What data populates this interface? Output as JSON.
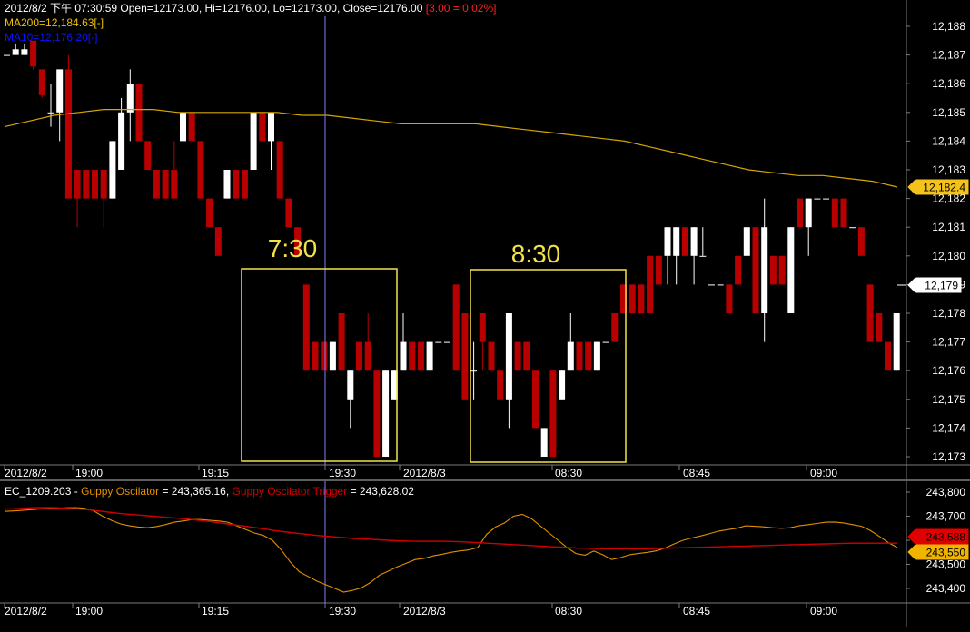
{
  "header": {
    "ohlc_text": "2012/8/2 下午 07:30:59 Open=12173.00, Hi=12176.00, Lo=12173.00, Close=12176.00",
    "change_text": "[3.00 = 0.02%]",
    "ma200_text": "MA200=12,184.63[-]",
    "ma10_text": "MA10=12,176.20[-]"
  },
  "colors": {
    "background": "#000000",
    "grid": "#7a7a7a",
    "up_candle": "#ffffff",
    "down_candle": "#b80000",
    "ma200": "#d4a600",
    "box": "#f2e24a",
    "header_text": "#ffffff",
    "change_text": "#ff2020",
    "ma200_label": "#f0c000",
    "ma10_label": "#1010ff",
    "guppy_line": "#e09000",
    "trigger_line": "#d00000",
    "crosshair": "#8080ff"
  },
  "annotations": [
    "7:30",
    "8:30"
  ],
  "chart_data": [
    {
      "type": "candlestick",
      "name": "price",
      "ylim": [
        12172.6,
        12188.3
      ],
      "y_ticks": [
        "12,173",
        "12,174",
        "12,175",
        "12,176",
        "12,177",
        "12,178",
        "12,179",
        "12,180",
        "12,181",
        "12,182",
        "12,183",
        "12,184",
        "12,185",
        "12,186",
        "12,187",
        "12,188"
      ],
      "x_tick_labels": [
        "2012/8/2",
        "19:00",
        "19:15",
        "19:30",
        "2012/8/3",
        "08:30",
        "08:45",
        "09:00"
      ],
      "last_price_label": "12,179",
      "ma200_label": "12,182.4",
      "ma200": [
        12184.5,
        12184.7,
        12184.9,
        12185.0,
        12185.1,
        12185.1,
        12185.1,
        12185.0,
        12185.0,
        12185.0,
        12185.0,
        12185.0,
        12184.9,
        12184.9,
        12184.8,
        12184.7,
        12184.6,
        12184.6,
        12184.6,
        12184.6,
        12184.5,
        12184.4,
        12184.3,
        12184.2,
        12184.1,
        12184.0,
        12183.8,
        12183.6,
        12183.4,
        12183.2,
        12183.0,
        12182.9,
        12182.8,
        12182.8,
        12182.7,
        12182.6,
        12182.4
      ],
      "candles": [
        {
          "o": 12187,
          "h": 12187,
          "l": 12187,
          "c": 12187
        },
        {
          "o": 12187,
          "h": 12187.4,
          "l": 12187,
          "c": 12187.2
        },
        {
          "o": 12187,
          "h": 12187.4,
          "l": 12187,
          "c": 12187.2
        },
        {
          "o": 12187.5,
          "h": 12187.5,
          "l": 12186.5,
          "c": 12186.6
        },
        {
          "o": 12186.5,
          "h": 12186.5,
          "l": 12185.5,
          "c": 12185.6
        },
        {
          "o": 12185,
          "h": 12186,
          "l": 12184.5,
          "c": 12185
        },
        {
          "o": 12185,
          "h": 12186.5,
          "l": 12184,
          "c": 12186.5
        },
        {
          "o": 12186.5,
          "h": 12187,
          "l": 12182,
          "c": 12182
        },
        {
          "o": 12183,
          "h": 12183,
          "l": 12181,
          "c": 12182
        },
        {
          "o": 12183,
          "h": 12183,
          "l": 12182,
          "c": 12182
        },
        {
          "o": 12183,
          "h": 12183,
          "l": 12182,
          "c": 12182
        },
        {
          "o": 12183,
          "h": 12183,
          "l": 12181,
          "c": 12182
        },
        {
          "o": 12182,
          "h": 12184,
          "l": 12182,
          "c": 12184
        },
        {
          "o": 12183,
          "h": 12185.5,
          "l": 12183,
          "c": 12185
        },
        {
          "o": 12185,
          "h": 12186.5,
          "l": 12184,
          "c": 12186
        },
        {
          "o": 12186,
          "h": 12186,
          "l": 12184,
          "c": 12184
        },
        {
          "o": 12184,
          "h": 12184,
          "l": 12183,
          "c": 12183
        },
        {
          "o": 12183,
          "h": 12183,
          "l": 12182,
          "c": 12182
        },
        {
          "o": 12183,
          "h": 12183,
          "l": 12182,
          "c": 12182
        },
        {
          "o": 12183,
          "h": 12184,
          "l": 12182,
          "c": 12182
        },
        {
          "o": 12184,
          "h": 12185,
          "l": 12183,
          "c": 12185
        },
        {
          "o": 12185,
          "h": 12185,
          "l": 12184,
          "c": 12184
        },
        {
          "o": 12184,
          "h": 12184,
          "l": 12182,
          "c": 12182
        },
        {
          "o": 12182,
          "h": 12182,
          "l": 12181,
          "c": 12181
        },
        {
          "o": 12181,
          "h": 12181,
          "l": 12180,
          "c": 12180
        },
        {
          "o": 12182,
          "h": 12183,
          "l": 12182,
          "c": 12183
        },
        {
          "o": 12183,
          "h": 12183,
          "l": 12182,
          "c": 12182
        },
        {
          "o": 12183,
          "h": 12183,
          "l": 12182,
          "c": 12182
        },
        {
          "o": 12183,
          "h": 12185,
          "l": 12183,
          "c": 12185
        },
        {
          "o": 12185,
          "h": 12185,
          "l": 12184,
          "c": 12184
        },
        {
          "o": 12184,
          "h": 12185,
          "l": 12183,
          "c": 12185
        },
        {
          "o": 12184,
          "h": 12184,
          "l": 12182,
          "c": 12182
        },
        {
          "o": 12182,
          "h": 12182,
          "l": 12181,
          "c": 12181
        },
        {
          "o": 12181,
          "h": 12181,
          "l": 12180,
          "c": 12180
        },
        {
          "o": 12179,
          "h": 12179,
          "l": 12176,
          "c": 12176
        },
        {
          "o": 12177,
          "h": 12177,
          "l": 12176,
          "c": 12176
        },
        {
          "o": 12177,
          "h": 12177,
          "l": 12176,
          "c": 12176
        },
        {
          "o": 12176,
          "h": 12177,
          "l": 12176,
          "c": 12177
        },
        {
          "o": 12178,
          "h": 12178,
          "l": 12176,
          "c": 12176
        },
        {
          "o": 12175,
          "h": 12176,
          "l": 12174,
          "c": 12176
        },
        {
          "o": 12177,
          "h": 12177,
          "l": 12176,
          "c": 12176
        },
        {
          "o": 12177,
          "h": 12178,
          "l": 12176,
          "c": 12176
        },
        {
          "o": 12176,
          "h": 12176,
          "l": 12173,
          "c": 12173
        },
        {
          "o": 12173,
          "h": 12176,
          "l": 12173,
          "c": 12176
        },
        {
          "o": 12175,
          "h": 12176,
          "l": 12175,
          "c": 12176
        },
        {
          "o": 12176,
          "h": 12178,
          "l": 12176,
          "c": 12177
        },
        {
          "o": 12177,
          "h": 12177,
          "l": 12176,
          "c": 12176
        },
        {
          "o": 12177,
          "h": 12177,
          "l": 12176,
          "c": 12176
        },
        {
          "o": 12176,
          "h": 12177,
          "l": 12176,
          "c": 12177
        },
        {
          "o": 12177,
          "h": 12177,
          "l": 12177,
          "c": 12177
        },
        {
          "o": 12177,
          "h": 12177,
          "l": 12177,
          "c": 12177
        },
        {
          "o": 12179,
          "h": 12179,
          "l": 12176,
          "c": 12176
        },
        {
          "o": 12178,
          "h": 12178,
          "l": 12175,
          "c": 12175
        },
        {
          "o": 12176,
          "h": 12177,
          "l": 12175,
          "c": 12176
        },
        {
          "o": 12178,
          "h": 12178,
          "l": 12176,
          "c": 12177
        },
        {
          "o": 12177,
          "h": 12177,
          "l": 12176,
          "c": 12176
        },
        {
          "o": 12176,
          "h": 12176,
          "l": 12175,
          "c": 12175
        },
        {
          "o": 12175,
          "h": 12178,
          "l": 12174,
          "c": 12178
        },
        {
          "o": 12177,
          "h": 12177,
          "l": 12176,
          "c": 12176
        },
        {
          "o": 12177,
          "h": 12177,
          "l": 12176,
          "c": 12176
        },
        {
          "o": 12176,
          "h": 12176,
          "l": 12174,
          "c": 12174
        },
        {
          "o": 12173,
          "h": 12174,
          "l": 12173,
          "c": 12174
        },
        {
          "o": 12176,
          "h": 12176,
          "l": 12173,
          "c": 12173
        },
        {
          "o": 12175,
          "h": 12176,
          "l": 12175,
          "c": 12176
        },
        {
          "o": 12176,
          "h": 12178,
          "l": 12176,
          "c": 12177
        },
        {
          "o": 12177,
          "h": 12177,
          "l": 12176,
          "c": 12176
        },
        {
          "o": 12177,
          "h": 12177,
          "l": 12176,
          "c": 12176
        },
        {
          "o": 12176,
          "h": 12177,
          "l": 12176,
          "c": 12177
        },
        {
          "o": 12177,
          "h": 12177,
          "l": 12177,
          "c": 12177
        },
        {
          "o": 12178,
          "h": 12178,
          "l": 12177,
          "c": 12177
        },
        {
          "o": 12179,
          "h": 12179,
          "l": 12178,
          "c": 12178
        },
        {
          "o": 12179,
          "h": 12179,
          "l": 12178,
          "c": 12178
        },
        {
          "o": 12179,
          "h": 12179,
          "l": 12178,
          "c": 12178
        },
        {
          "o": 12180,
          "h": 12180,
          "l": 12178,
          "c": 12178
        },
        {
          "o": 12180,
          "h": 12180,
          "l": 12179,
          "c": 12179
        },
        {
          "o": 12180,
          "h": 12181,
          "l": 12179,
          "c": 12181
        },
        {
          "o": 12180,
          "h": 12181,
          "l": 12179,
          "c": 12181
        },
        {
          "o": 12181,
          "h": 12181,
          "l": 12180,
          "c": 12180
        },
        {
          "o": 12180,
          "h": 12181,
          "l": 12179,
          "c": 12181
        },
        {
          "o": 12180,
          "h": 12181,
          "l": 12180,
          "c": 12180
        },
        {
          "o": 12179,
          "h": 12179,
          "l": 12179,
          "c": 12179
        },
        {
          "o": 12179,
          "h": 12179,
          "l": 12179,
          "c": 12179
        },
        {
          "o": 12179,
          "h": 12179,
          "l": 12178,
          "c": 12178
        },
        {
          "o": 12180,
          "h": 12180,
          "l": 12179,
          "c": 12179
        },
        {
          "o": 12180,
          "h": 12181,
          "l": 12180,
          "c": 12181
        },
        {
          "o": 12181,
          "h": 12181,
          "l": 12178,
          "c": 12178
        },
        {
          "o": 12178,
          "h": 12182,
          "l": 12177,
          "c": 12181
        },
        {
          "o": 12180,
          "h": 12180,
          "l": 12179,
          "c": 12179
        },
        {
          "o": 12180,
          "h": 12180,
          "l": 12179,
          "c": 12179
        },
        {
          "o": 12178,
          "h": 12181,
          "l": 12178,
          "c": 12181
        },
        {
          "o": 12182,
          "h": 12182,
          "l": 12181,
          "c": 12181
        },
        {
          "o": 12181,
          "h": 12182,
          "l": 12180,
          "c": 12182
        },
        {
          "o": 12182,
          "h": 12182,
          "l": 12182,
          "c": 12182
        },
        {
          "o": 12182,
          "h": 12182,
          "l": 12182,
          "c": 12182
        },
        {
          "o": 12182,
          "h": 12182,
          "l": 12181,
          "c": 12181
        },
        {
          "o": 12182,
          "h": 12182,
          "l": 12181,
          "c": 12181
        },
        {
          "o": 12181,
          "h": 12181,
          "l": 12181,
          "c": 12181
        },
        {
          "o": 12181,
          "h": 12181,
          "l": 12180,
          "c": 12180
        },
        {
          "o": 12179,
          "h": 12179,
          "l": 12177,
          "c": 12177
        },
        {
          "o": 12178,
          "h": 12178,
          "l": 12177,
          "c": 12177
        },
        {
          "o": 12177,
          "h": 12177,
          "l": 12176,
          "c": 12176
        },
        {
          "o": 12176,
          "h": 12178,
          "l": 12176,
          "c": 12178
        }
      ]
    },
    {
      "type": "line",
      "name": "oscillator",
      "title": "EC_1209.203 -",
      "ylim": [
        243380,
        243820
      ],
      "y_ticks": [
        "243,400",
        "243,500",
        "243,600",
        "243,700",
        "243,800"
      ],
      "x_tick_labels": [
        "2012/8/2",
        "19:00",
        "19:15",
        "19:30",
        "2012/8/3",
        "08:30",
        "08:45",
        "09:00"
      ],
      "legend": [
        {
          "name": "Guppy Oscilator",
          "value_text": "= 243,365.16,"
        },
        {
          "name": "Guppy Oscilator Trigger",
          "value_text": "= 243,628.02"
        }
      ],
      "trigger_label": "243,588",
      "guppy_label": "243,550",
      "series": [
        {
          "name": "Guppy Oscilator",
          "values": [
            243720,
            243722,
            243724,
            243727,
            243730,
            243732,
            243733,
            243735,
            243736,
            243733,
            243722,
            243700,
            243682,
            243668,
            243660,
            243655,
            243652,
            243657,
            243665,
            243675,
            243680,
            243686,
            243686,
            243683,
            243680,
            243675,
            243660,
            243645,
            243630,
            243620,
            243600,
            243560,
            243510,
            243470,
            243450,
            243430,
            243415,
            243400,
            243385,
            243392,
            243403,
            243425,
            243455,
            243472,
            243490,
            243505,
            243520,
            243525,
            243535,
            243542,
            243550,
            243556,
            243560,
            243570,
            243625,
            243655,
            243672,
            243700,
            243708,
            243690,
            243660,
            243630,
            243600,
            243570,
            243545,
            243538,
            243555,
            243540,
            243520,
            243528,
            243540,
            243545,
            243550,
            243556,
            243568,
            243585,
            243600,
            243610,
            243618,
            243628,
            243638,
            243644,
            243650,
            243660,
            243658,
            243656,
            243652,
            243650,
            243652,
            243660,
            243665,
            243670,
            243675,
            243676,
            243672,
            243665,
            243658,
            243640,
            243616,
            243590,
            243570
          ]
        },
        {
          "name": "Guppy Oscilator Trigger",
          "values": [
            243730,
            243731,
            243733,
            243735,
            243736,
            243736,
            243735,
            243733,
            243731,
            243728,
            243724,
            243720,
            243715,
            243711,
            243708,
            243705,
            243702,
            243699,
            243696,
            243693,
            243690,
            243686,
            243682,
            243678,
            243673,
            243668,
            243663,
            243658,
            243653,
            243648,
            243642,
            243637,
            243632,
            243628,
            243624,
            243620,
            243617,
            243614,
            243611,
            243608,
            243606,
            243604,
            243602,
            243600,
            243598,
            243597,
            243596,
            243596,
            243596,
            243596,
            243595,
            243594,
            243592,
            243590,
            243588,
            243586,
            243584,
            243582,
            243580,
            243578,
            243576,
            243574,
            243572,
            243570,
            243568,
            243567,
            243566,
            243565,
            243565,
            243565,
            243565,
            243565,
            243565,
            243566,
            243567,
            243568,
            243569,
            243570,
            243571,
            243572,
            243573,
            243574,
            243575,
            243576,
            243577,
            243578,
            243579,
            243580,
            243581,
            243582,
            243583,
            243584,
            243585,
            243586,
            243587,
            243588,
            243588,
            243588,
            243588,
            243588,
            243588
          ]
        }
      ]
    }
  ]
}
